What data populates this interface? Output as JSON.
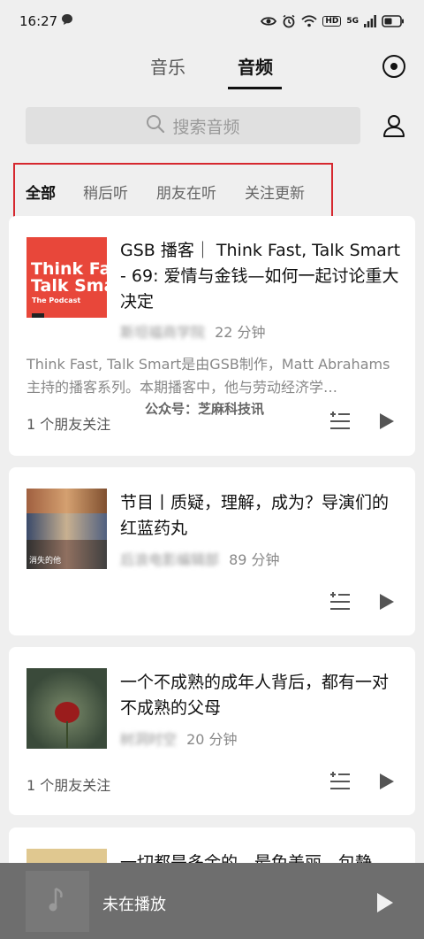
{
  "status_bar": {
    "time": "16:27",
    "network": "5G",
    "hd": "HD"
  },
  "top_tabs": [
    {
      "label": "音乐"
    },
    {
      "label": "音频"
    }
  ],
  "search": {
    "placeholder": "搜索音频"
  },
  "filter_tabs": [
    {
      "label": "全部",
      "active": true
    },
    {
      "label": "稍后听",
      "active": false
    },
    {
      "label": "朋友在听",
      "active": false
    },
    {
      "label": "关注更新",
      "active": false
    }
  ],
  "episodes": [
    {
      "title": "GSB 播客｜ Think Fast, Talk Smart - 69: 爱情与金钱—如何一起讨论重大决定",
      "source": "斯坦福商学院",
      "duration": "22 分钟",
      "description": "Think Fast, Talk Smart是由GSB制作，Matt Abrahams主持的播客系列。本期播客中，他与劳动经济学…",
      "friends": "1 个朋友关注",
      "cover_text_1": "Think Fas",
      "cover_text_2": "Talk Sma",
      "cover_text_3": "The Podcast",
      "cover_color": "#e8473a"
    },
    {
      "title": "节目丨质疑，理解，成为？导演们的红蓝药丸",
      "source": "后浪电影编辑部",
      "duration": "89 分钟",
      "cover_caption": "消失的他"
    },
    {
      "title": "一个不成熟的成年人背后，都有一对不成熟的父母",
      "source": "树洞时空",
      "duration": "20 分钟",
      "friends": "1 个朋友关注"
    },
    {
      "title": "一切都是多余的，最免美丽，包静"
    }
  ],
  "watermark": "公众号：芝麻科技讯",
  "player": {
    "status": "未在播放"
  },
  "colors": {
    "highlight_border": "#d6282f",
    "player_bg": "#6e6e6e"
  }
}
